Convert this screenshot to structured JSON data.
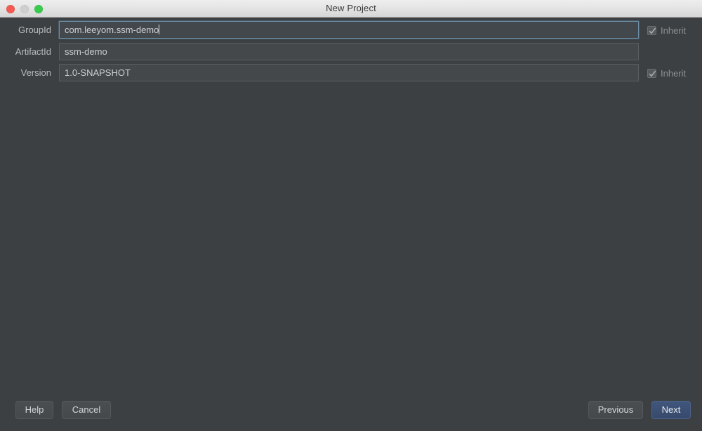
{
  "window": {
    "title": "New Project",
    "traffic_lights": [
      {
        "name": "close",
        "color": "#f45a51"
      },
      {
        "name": "minimize",
        "color": "#cfcfcf"
      },
      {
        "name": "zoom",
        "color": "#38cc4c"
      }
    ],
    "background_color": "#3c4042"
  },
  "form": {
    "fields": [
      {
        "label": "GroupId",
        "value": "com.leeyom.ssm-demo",
        "focused": true,
        "has_caret": true,
        "inherit": {
          "label": "Inherit",
          "checked": true,
          "enabled": false
        }
      },
      {
        "label": "ArtifactId",
        "value": "ssm-demo",
        "focused": false,
        "has_caret": false,
        "inherit": null
      },
      {
        "label": "Version",
        "value": "1.0-SNAPSHOT",
        "focused": false,
        "has_caret": false,
        "inherit": {
          "label": "Inherit",
          "checked": true,
          "enabled": false
        }
      }
    ]
  },
  "footer": {
    "help_label": "Help",
    "cancel_label": "Cancel",
    "previous_label": "Previous",
    "next_label": "Next",
    "next_accent_color": "#3d5278"
  }
}
